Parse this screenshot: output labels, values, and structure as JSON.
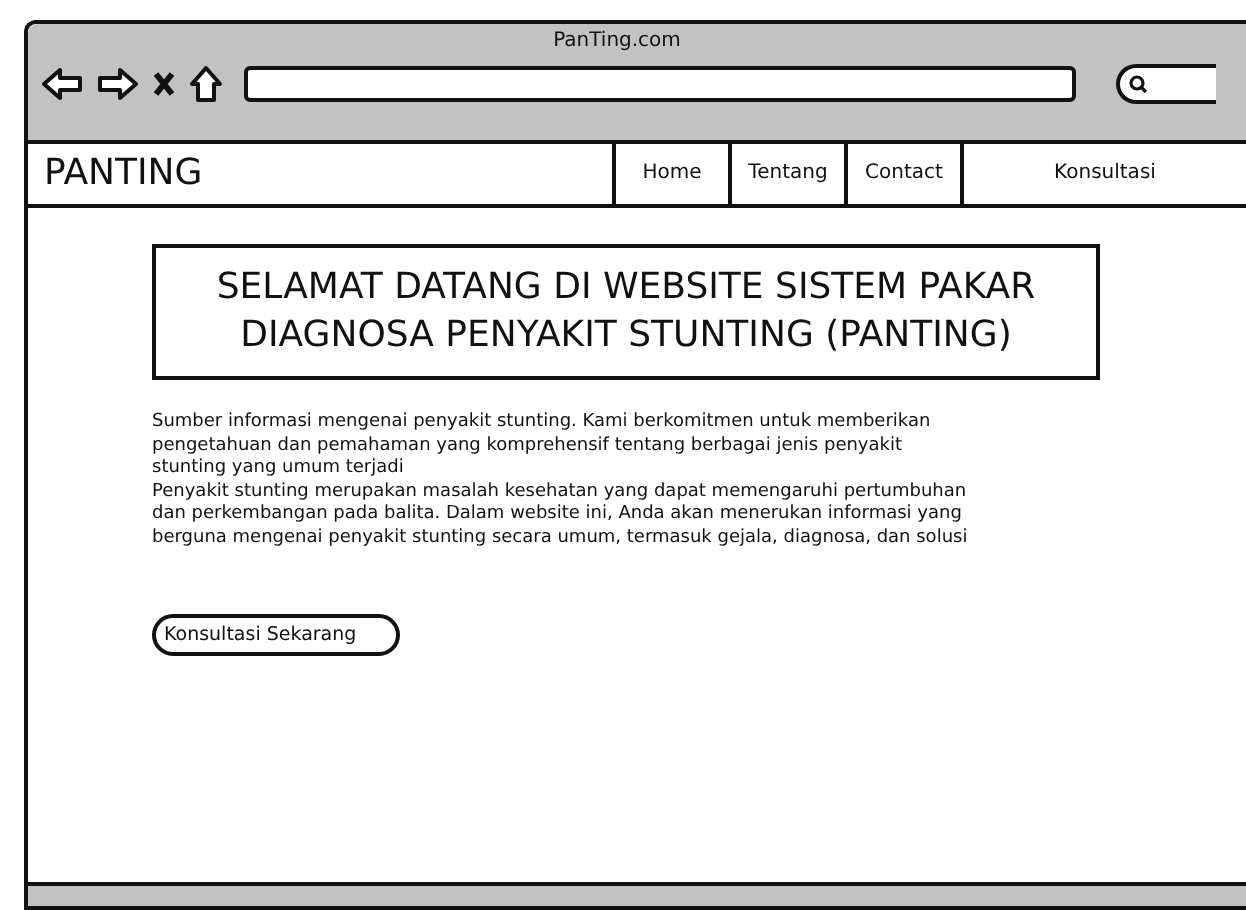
{
  "browser": {
    "title": "PanTing.com"
  },
  "site": {
    "logo": "PANTING",
    "nav": [
      {
        "label": "Home"
      },
      {
        "label": "Tentang"
      },
      {
        "label": "Contact"
      },
      {
        "label": "Konsultasi"
      }
    ]
  },
  "heading": "SELAMAT DATANG DI WEBSITE SISTEM PAKAR DIAGNOSA PENYAKIT STUNTING (PANTING)",
  "paragraphs": [
    "Sumber informasi mengenai penyakit stunting. Kami berkomitmen untuk memberikan pengetahuan dan pemahaman yang komprehensif tentang berbagai jenis penyakit stunting yang umum terjadi",
    "Penyakit stunting merupakan masalah kesehatan yang dapat memengaruhi pertumbuhan dan perkembangan pada balita. Dalam website ini, Anda akan menerukan informasi yang berguna mengenai penyakit stunting secara umum, termasuk gejala, diagnosa, dan solusi"
  ],
  "button": "Konsultasi Sekarang"
}
